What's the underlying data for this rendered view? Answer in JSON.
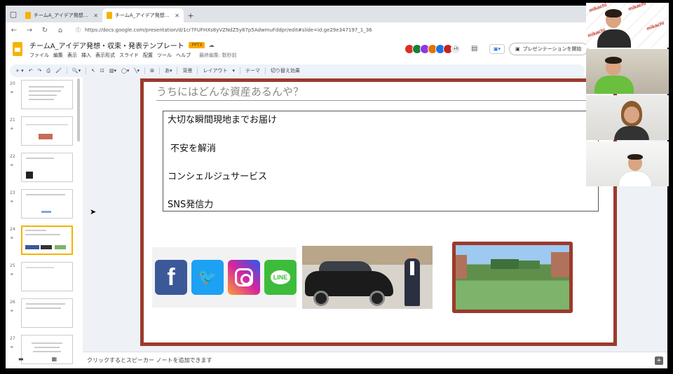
{
  "browser": {
    "tabs": [
      {
        "title": "チームA_アイデア発想・収束・発表テ"
      },
      {
        "title": "チームA_アイデア発想・収束・発表テ"
      }
    ],
    "url": "https://docs.google.com/presentation/d/1cr7FUFHXs8yVZNdZ5y87p5AdwmuFddpr/edit#slide=id.ge29e347197_1_36"
  },
  "docs": {
    "title": "チームA_アイデア発想・収束・発表テンプレート",
    "badge": ".PPTX",
    "menu": [
      "ファイル",
      "編集",
      "表示",
      "挿入",
      "表示形式",
      "スライド",
      "配置",
      "ツール",
      "ヘルプ"
    ],
    "last_edit": "最終編集: 数秒前",
    "avatar_more": "+6",
    "present_label": "プレゼンテーションを開始",
    "avatar_colors": [
      "#d93025",
      "#188038",
      "#9334e6",
      "#e37400",
      "#1a73e8",
      "#c5221f"
    ]
  },
  "toolbar": {
    "background": "背景",
    "layout": "レイアウト",
    "theme": "テーマ",
    "transition": "切り替え効果"
  },
  "filmstrip": {
    "slides": [
      {
        "num": "20"
      },
      {
        "num": "21"
      },
      {
        "num": "22"
      },
      {
        "num": "23"
      },
      {
        "num": "24",
        "active": true
      },
      {
        "num": "25"
      },
      {
        "num": "26"
      },
      {
        "num": "27"
      }
    ]
  },
  "slide": {
    "title": "うちにはどんな資産あるんや？",
    "items": [
      "大切な瞬間現地までお届け",
      "不安を解消",
      "コンシェルジュサービス",
      "SNS発信力"
    ],
    "social_icons": [
      {
        "name": "facebook",
        "glyph": "f"
      },
      {
        "name": "twitter",
        "glyph": "🐦"
      },
      {
        "name": "instagram",
        "glyph": ""
      },
      {
        "name": "line",
        "glyph": "LINE"
      }
    ]
  },
  "notes": {
    "placeholder": "クリックするとスピーカー ノートを追加できます"
  },
  "video": {
    "watermark": "mikachi"
  }
}
